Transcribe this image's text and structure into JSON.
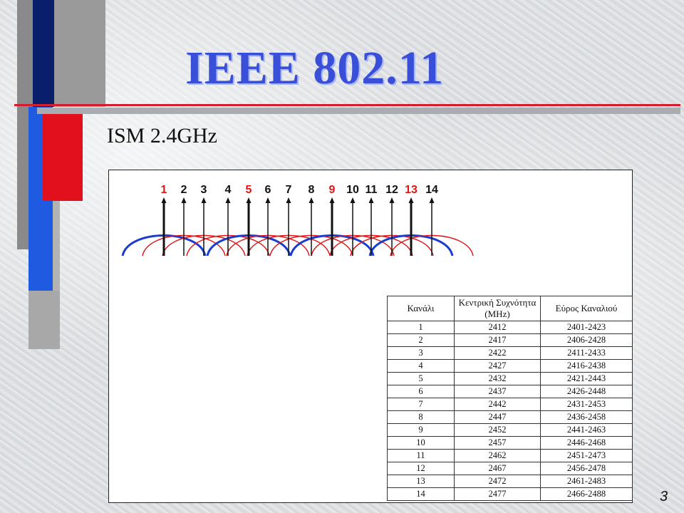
{
  "slide": {
    "title": "IEEE 802.11",
    "subtitle": "ISM 2.4GHz",
    "page_number": "3"
  },
  "colors": {
    "title": "#3a4fd8",
    "accent_red": "#e0101c",
    "accent_blue": "#1f5be0",
    "accent_navy": "#0a1f6b",
    "curve_red": "#e01515",
    "curve_blue": "#1a3ccf"
  },
  "channel_diagram": {
    "channels": [
      {
        "label": "1",
        "highlight": true
      },
      {
        "label": "2",
        "highlight": false
      },
      {
        "label": "3",
        "highlight": false
      },
      {
        "label": "4",
        "highlight": false
      },
      {
        "label": "5",
        "highlight": true
      },
      {
        "label": "6",
        "highlight": false
      },
      {
        "label": "7",
        "highlight": false
      },
      {
        "label": "8",
        "highlight": false
      },
      {
        "label": "9",
        "highlight": true
      },
      {
        "label": "10",
        "highlight": false
      },
      {
        "label": "11",
        "highlight": false
      },
      {
        "label": "12",
        "highlight": false
      },
      {
        "label": "13",
        "highlight": true
      },
      {
        "label": "14",
        "highlight": false
      }
    ]
  },
  "table": {
    "headers": [
      "Κανάλι",
      "Κεντρική Συχνότητα (MHz)",
      "Εύρος Καναλιού"
    ],
    "rows": [
      [
        "1",
        "2412",
        "2401-2423"
      ],
      [
        "2",
        "2417",
        "2406-2428"
      ],
      [
        "3",
        "2422",
        "2411-2433"
      ],
      [
        "4",
        "2427",
        "2416-2438"
      ],
      [
        "5",
        "2432",
        "2421-2443"
      ],
      [
        "6",
        "2437",
        "2426-2448"
      ],
      [
        "7",
        "2442",
        "2431-2453"
      ],
      [
        "8",
        "2447",
        "2436-2458"
      ],
      [
        "9",
        "2452",
        "2441-2463"
      ],
      [
        "10",
        "2457",
        "2446-2468"
      ],
      [
        "11",
        "2462",
        "2451-2473"
      ],
      [
        "12",
        "2467",
        "2456-2478"
      ],
      [
        "13",
        "2472",
        "2461-2483"
      ],
      [
        "14",
        "2477",
        "2466-2488"
      ]
    ]
  }
}
